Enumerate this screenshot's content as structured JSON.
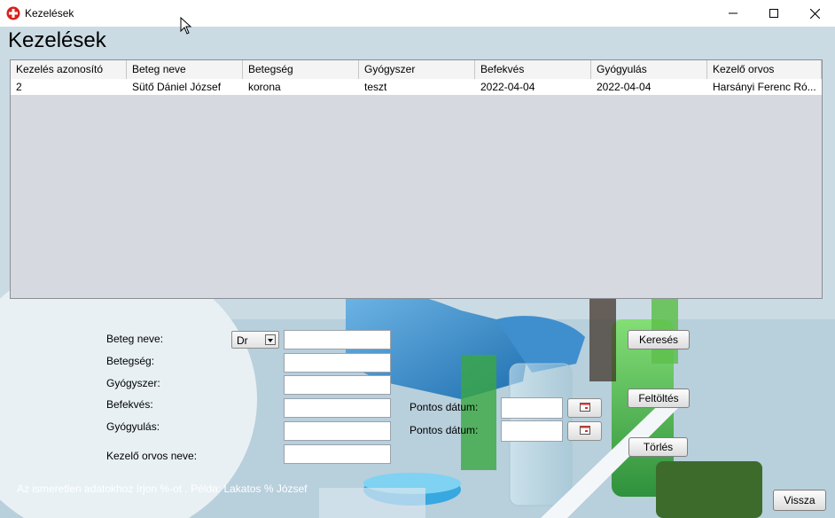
{
  "window": {
    "title": "Kezelések"
  },
  "heading": "Kezelések",
  "table": {
    "columns": [
      "Kezelés azonosító",
      "Beteg neve",
      "Betegség",
      "Gyógyszer",
      "Befekvés",
      "Gyógyulás",
      "Kezelő orvos"
    ],
    "rows": [
      [
        "2",
        "Sütő Dániel József",
        "korona",
        "teszt",
        "2022-04-04",
        "2022-04-04",
        "Harsányi Ferenc Ró..."
      ]
    ]
  },
  "form": {
    "beteg_neve_label": "Beteg neve:",
    "betegseg_label": "Betegség:",
    "gyogyszer_label": "Gyógyszer:",
    "befekves_label": "Befekvés:",
    "gyogyulas_label": "Gyógyulás:",
    "kezelo_orvos_label": "Kezelő orvos neve:",
    "title_select_value": "Dr",
    "pontos_datum_1": "Pontos dátum:",
    "pontos_datum_2": "Pontos dátum:"
  },
  "buttons": {
    "kereses": "Keresés",
    "feltoltes": "Feltöltés",
    "torles": "Törlés",
    "vissza": "Vissza"
  },
  "hint": "Az ismeretlen adatokhoz írjon %-ot . Példa: Lakatos % József",
  "colors": {
    "accent_red": "#d9201a",
    "table_bg": "#d6d9e0"
  }
}
